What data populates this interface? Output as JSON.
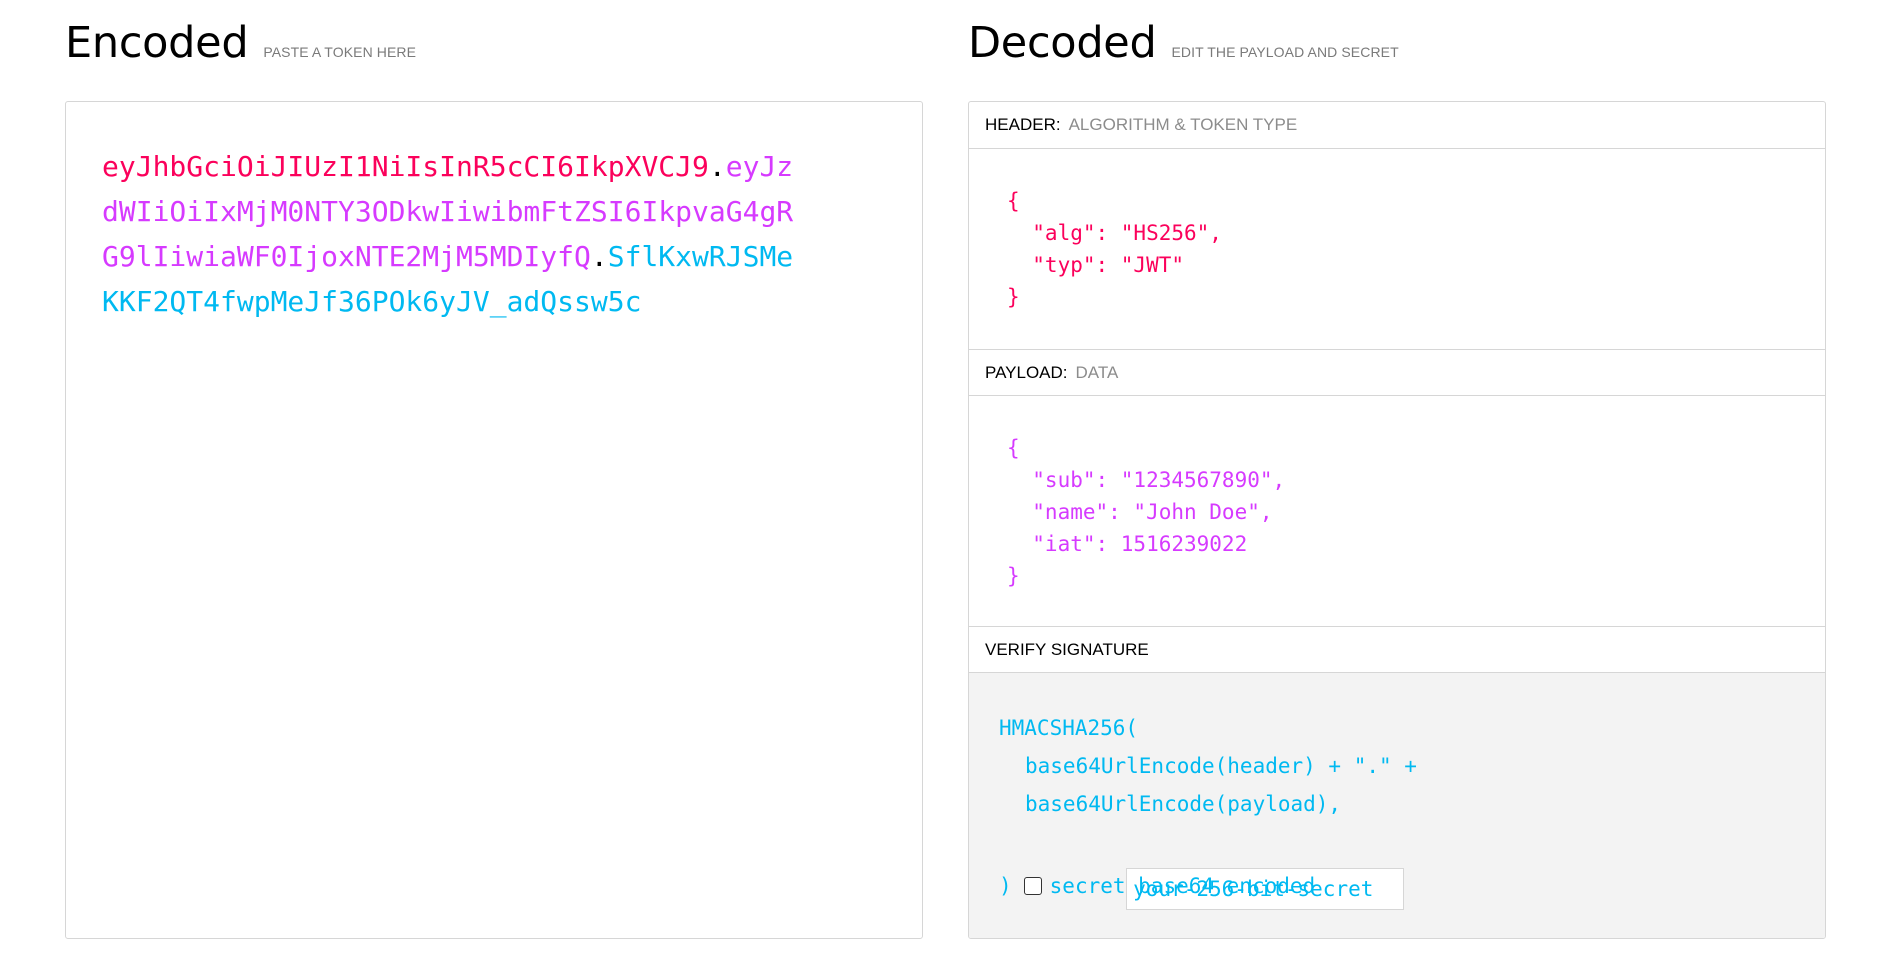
{
  "encoded": {
    "title": "Encoded",
    "subtitle": "PASTE A TOKEN HERE",
    "token": {
      "header": "eyJhbGciOiJIUzI1NiIsInR5cCI6IkpXVCJ9",
      "dot1": ".",
      "payload": "eyJzdWIiOiIxMjM0NTY3ODkwIiwibmFtZSI6IkpvaG4gRG9lIiwiaWF0IjoxNTE2MjM5MDIyfQ",
      "dot2": ".",
      "signature": "SflKxwRJSMeKKF2QT4fwpMeJf36POk6yJV_adQssw5c"
    }
  },
  "decoded": {
    "title": "Decoded",
    "subtitle": "EDIT THE PAYLOAD AND SECRET",
    "header_section": {
      "label": "HEADER:",
      "hint": "ALGORITHM & TOKEN TYPE",
      "json": "{\n  \"alg\": \"HS256\",\n  \"typ\": \"JWT\"\n}"
    },
    "payload_section": {
      "label": "PAYLOAD:",
      "hint": "DATA",
      "json": "{\n  \"sub\": \"1234567890\",\n  \"name\": \"John Doe\",\n  \"iat\": 1516239022\n}"
    },
    "verify_section": {
      "label": "VERIFY SIGNATURE",
      "fn_open": "HMACSHA256(",
      "line1": "base64UrlEncode(header) + \".\" +",
      "line2": "base64UrlEncode(payload),",
      "secret_placeholder": "your-256-bit-secret",
      "fn_close": ")",
      "checkbox_label": "secret base64 encoded",
      "checkbox_checked": false
    }
  },
  "colors": {
    "header": "#fb015b",
    "payload": "#d63aff",
    "signature": "#00b9f1"
  }
}
